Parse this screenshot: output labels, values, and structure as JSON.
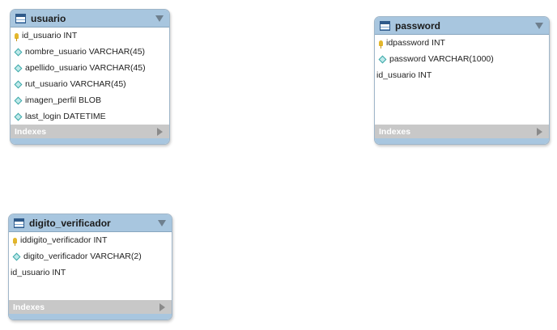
{
  "tables": {
    "usuario": {
      "title": "usuario",
      "columns": [
        {
          "text": "id_usuario INT",
          "icon": "primary-key-icon"
        },
        {
          "text": "nombre_usuario VARCHAR(45)",
          "icon": "column-diamond-icon"
        },
        {
          "text": "apellido_usuario VARCHAR(45)",
          "icon": "column-diamond-icon"
        },
        {
          "text": "rut_usuario VARCHAR(45)",
          "icon": "column-diamond-icon"
        },
        {
          "text": "imagen_perfil BLOB",
          "icon": "column-diamond-icon"
        },
        {
          "text": "last_login DATETIME",
          "icon": "column-diamond-icon"
        }
      ],
      "indexes_label": "Indexes"
    },
    "password": {
      "title": "password",
      "columns": [
        {
          "text": "idpassword INT",
          "icon": "primary-key-icon"
        },
        {
          "text": "password VARCHAR(1000)",
          "icon": "column-diamond-icon"
        },
        {
          "text": "id_usuario INT",
          "icon": "none"
        }
      ],
      "indexes_label": "Indexes"
    },
    "digito_verificador": {
      "title": "digito_verificador",
      "columns": [
        {
          "text": "iddigito_verificador INT",
          "icon": "primary-key-icon"
        },
        {
          "text": "digito_verificador VARCHAR(2)",
          "icon": "column-diamond-icon"
        },
        {
          "text": "id_usuario INT",
          "icon": "none"
        }
      ],
      "indexes_label": "Indexes"
    }
  },
  "colors": {
    "header": "#a8c6df",
    "footer": "#c8c8c8",
    "primary_key": "#e3b72c",
    "column_diamond": "#3aa8a8"
  }
}
